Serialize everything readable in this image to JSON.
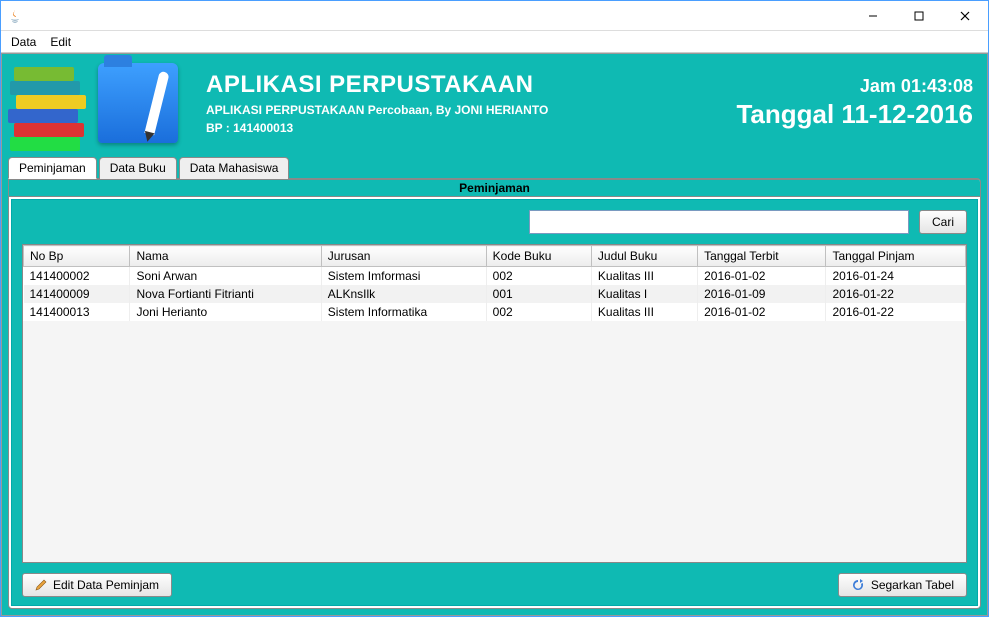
{
  "menu": {
    "data": "Data",
    "edit": "Edit"
  },
  "banner": {
    "title": "APLIKASI PERPUSTAKAAN",
    "subtitle": "APLIKASI PERPUSTAKAAN Percobaan, By JONI HERIANTO",
    "bp": "BP : 141400013",
    "clock": "Jam 01:43:08",
    "date": "Tanggal 11-12-2016"
  },
  "tabs": {
    "peminjaman": "Peminjaman",
    "dataBuku": "Data Buku",
    "dataMahasiswa": "Data Mahasiswa"
  },
  "panel": {
    "title": "Peminjaman",
    "searchButton": "Cari",
    "editButton": "Edit Data Peminjam",
    "refreshButton": "Segarkan Tabel",
    "searchValue": ""
  },
  "table": {
    "headers": {
      "noBp": "No Bp",
      "nama": "Nama",
      "jurusan": "Jurusan",
      "kodeBuku": "Kode Buku",
      "judulBuku": "Judul Buku",
      "tanggalTerbit": "Tanggal Terbit",
      "tanggalPinjam": "Tanggal Pinjam"
    },
    "rows": [
      {
        "noBp": "141400002",
        "nama": "Soni Arwan",
        "jurusan": "Sistem Imformasi",
        "kodeBuku": "002",
        "judulBuku": "Kualitas III",
        "tanggalTerbit": "2016-01-02",
        "tanggalPinjam": "2016-01-24"
      },
      {
        "noBp": "141400009",
        "nama": "Nova Fortianti Fitrianti",
        "jurusan": "ALKnsIlk",
        "kodeBuku": "001",
        "judulBuku": "Kualitas I",
        "tanggalTerbit": "2016-01-09",
        "tanggalPinjam": "2016-01-22"
      },
      {
        "noBp": "141400013",
        "nama": "Joni Herianto",
        "jurusan": "Sistem Informatika",
        "kodeBuku": "002",
        "judulBuku": "Kualitas III",
        "tanggalTerbit": "2016-01-02",
        "tanggalPinjam": "2016-01-22"
      }
    ]
  }
}
